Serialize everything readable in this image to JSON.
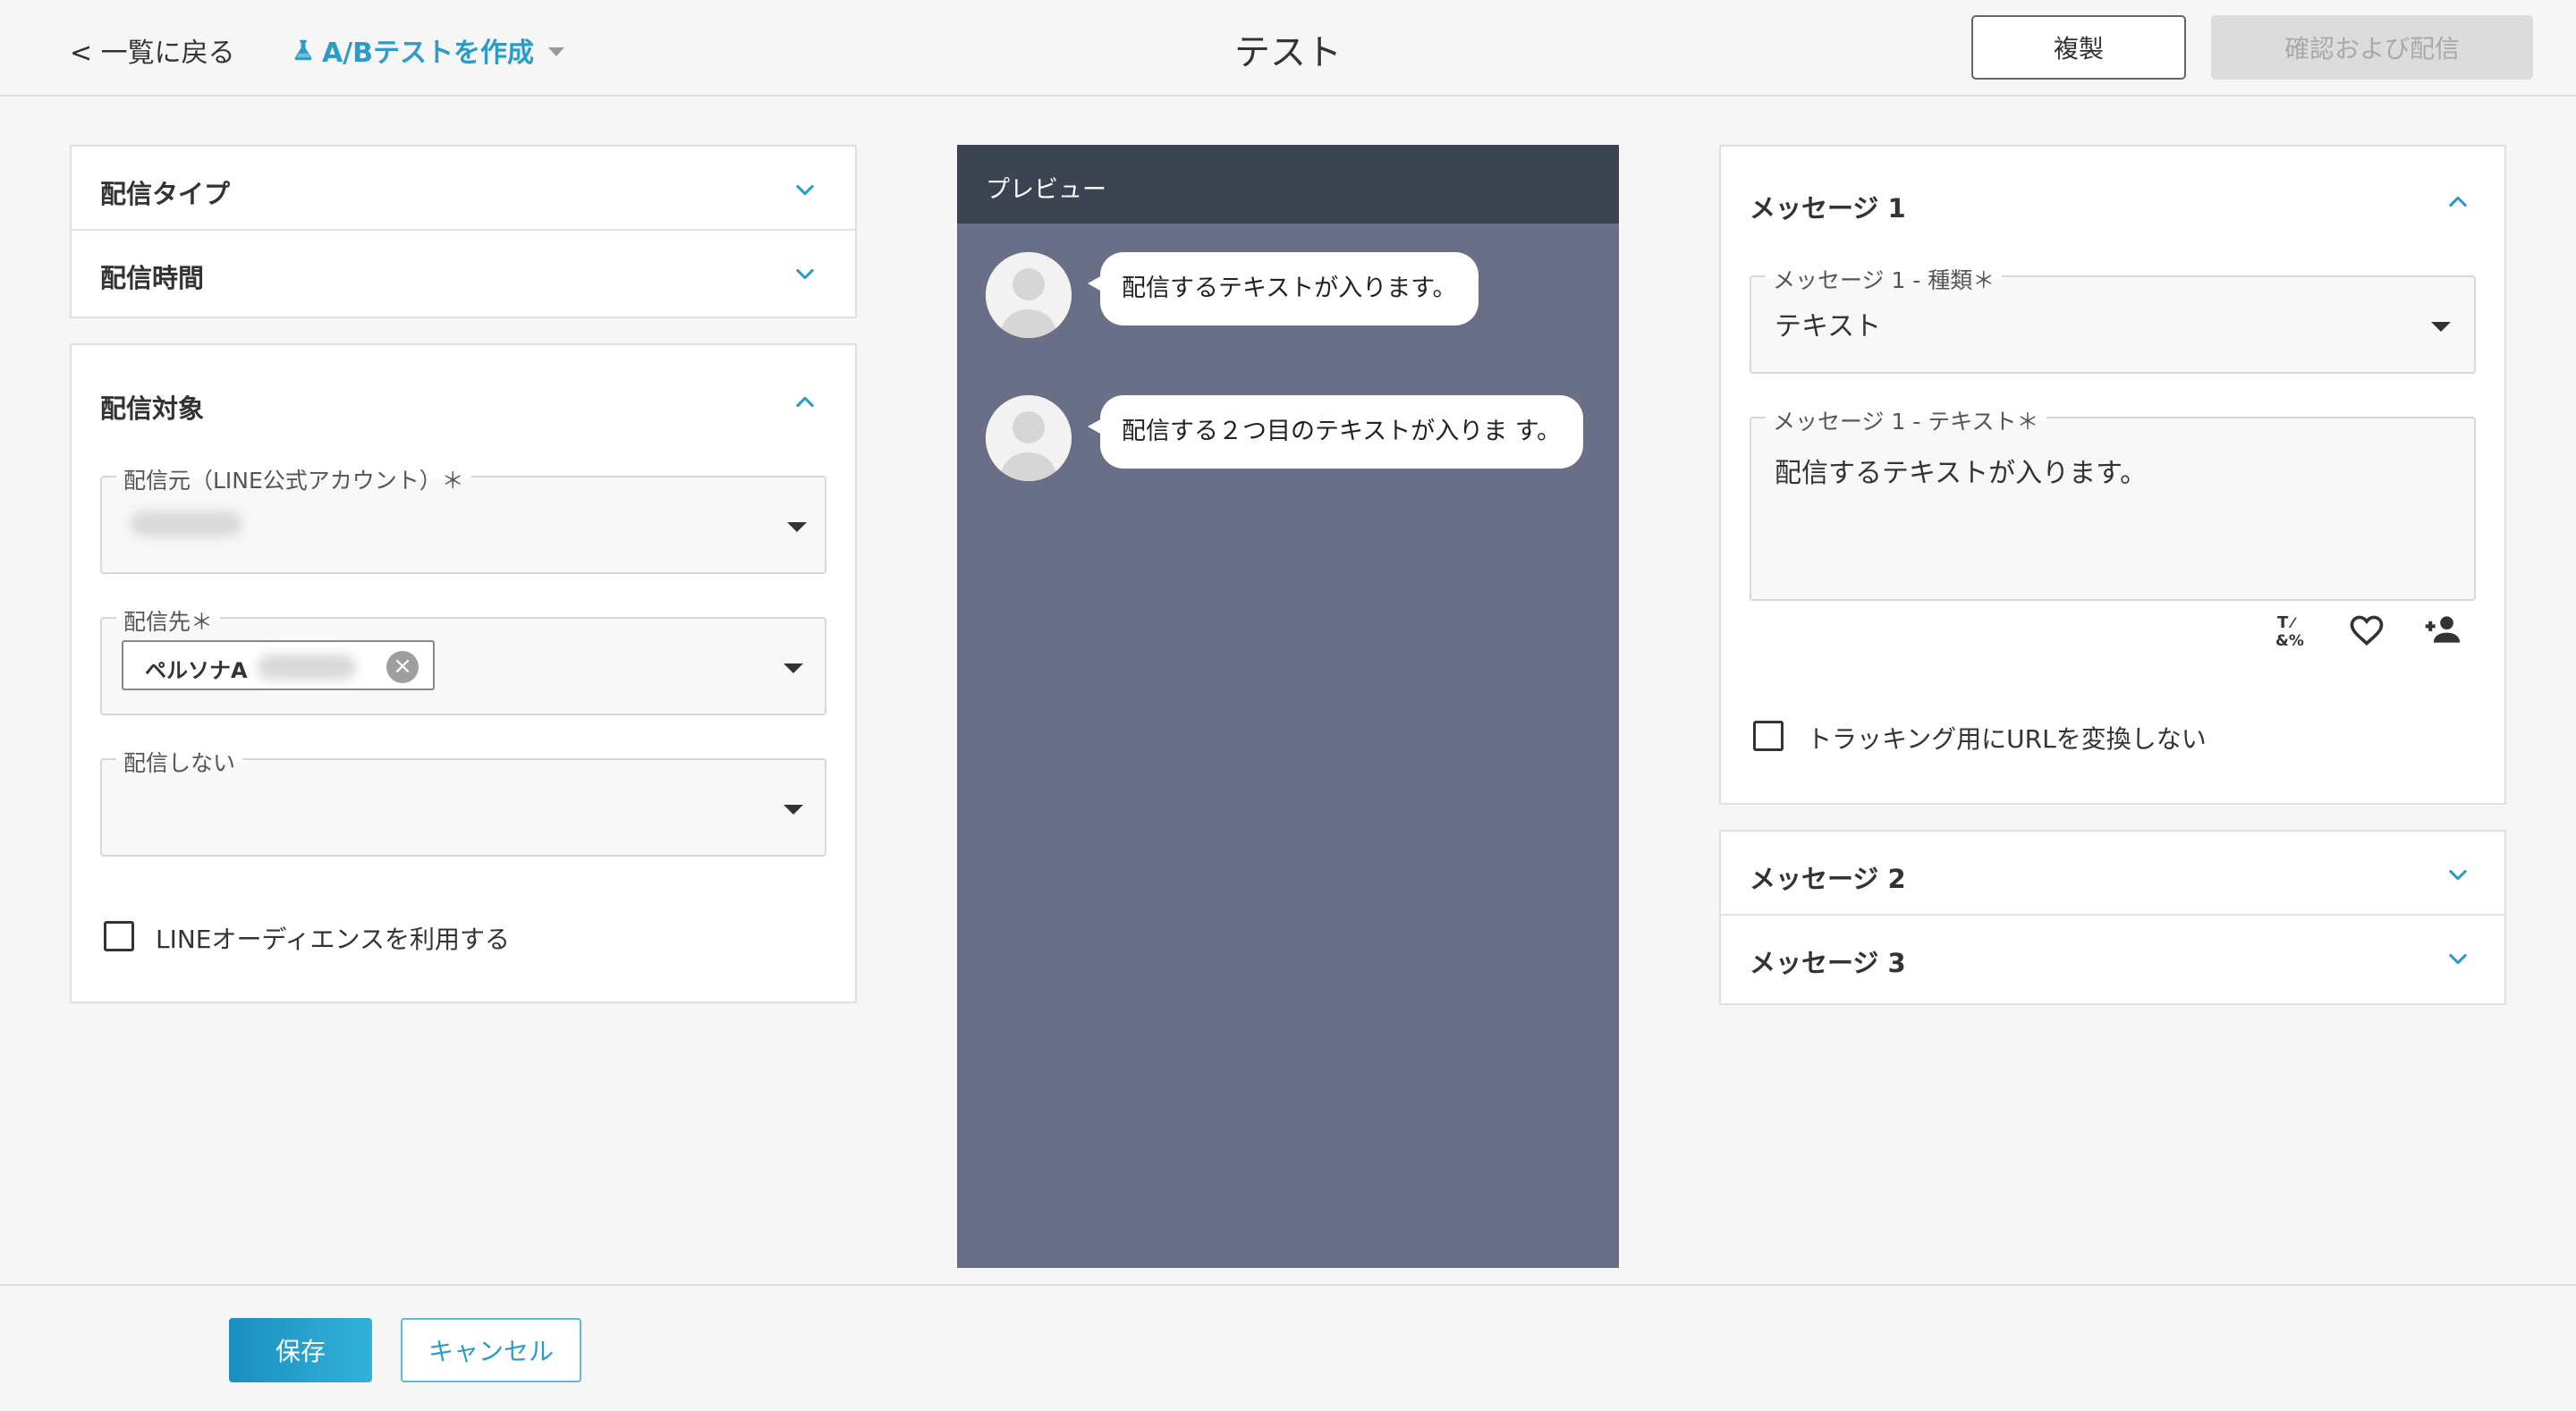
{
  "header": {
    "back_label": "< 一覧に戻る",
    "ab_label": "A/Bテストを作成",
    "title": "テスト",
    "duplicate_label": "複製",
    "confirm_label": "確認および配信"
  },
  "left": {
    "delivery_type": "配信タイプ",
    "delivery_time": "配信時間",
    "target": {
      "title": "配信対象",
      "source_label": "配信元（LINE公式アカウント）＊",
      "dest_label": "配信先＊",
      "dest_chip": "ペルソナA",
      "exclude_label": "配信しない",
      "audience_checkbox": "LINEオーディエンスを利用する"
    }
  },
  "preview": {
    "title": "プレビュー",
    "messages": [
      "配信するテキストが入ります。",
      "配信する２つ目のテキストが入りま す。"
    ]
  },
  "right": {
    "message1": {
      "title": "メッセージ 1",
      "type_label": "メッセージ 1 - 種類＊",
      "type_value": "テキスト",
      "text_label": "メッセージ 1 - テキスト＊",
      "text_value": "配信するテキストが入ります。",
      "tracking_checkbox": "トラッキング用にURLを変換しない"
    },
    "message2_title": "メッセージ 2",
    "message3_title": "メッセージ 3"
  },
  "footer": {
    "save_label": "保存",
    "cancel_label": "キャンセル"
  },
  "icons": {
    "flask": "flask-icon",
    "chevron_down": "chevron-down-icon",
    "chevron_up": "chevron-up-icon",
    "clear": "clear-icon",
    "special_char": "special-character-icon",
    "heart": "heart-icon",
    "add_person": "add-person-icon",
    "avatar": "avatar-icon"
  },
  "colors": {
    "accent": "#2b9bc8",
    "preview_bg": "#686f86",
    "preview_header": "#3d4451"
  }
}
